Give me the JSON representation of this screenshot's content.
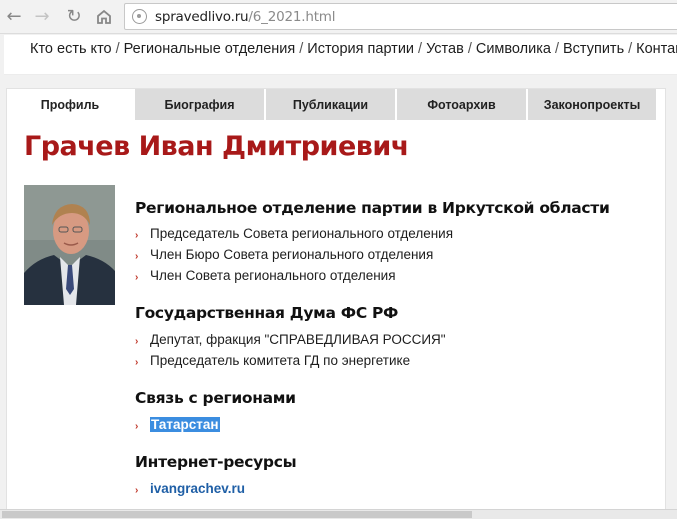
{
  "browser": {
    "url_domain": "spravedlivo.ru",
    "url_path": "/6_2021.html",
    "back_icon": "arrow-left",
    "forward_icon": "arrow-right",
    "reload_icon": "reload"
  },
  "topmenu": {
    "items": [
      "Кто есть кто",
      "Региональные отделения",
      "История партии",
      "Устав",
      "Символика",
      "Вступить",
      "Контак"
    ],
    "separator": "/"
  },
  "tabs": [
    "Профиль",
    "Биография",
    "Публикации",
    "Фотоархив",
    "Законопроекты"
  ],
  "active_tab": "Профиль",
  "profile": {
    "name": "Грачев Иван Дмитриевич",
    "sections": [
      {
        "heading": "Региональное отделение партии в Иркутской области",
        "items": [
          "Председатель Совета регионального отделения",
          "Член Бюро Совета регионального отделения",
          "Член Совета регионального отделения"
        ]
      },
      {
        "heading": "Государственная Дума ФС РФ",
        "items": [
          "Депутат, фракция \"СПРАВЕДЛИВАЯ РОССИЯ\"",
          "Председатель комитета ГД по энергетике"
        ]
      },
      {
        "heading": "Связь с регионами",
        "items": [
          "Татарстан"
        ]
      },
      {
        "heading": "Интернет-ресурсы",
        "items": [
          "ivangrachev.ru"
        ]
      }
    ]
  },
  "colors": {
    "title": "#a81919",
    "bullet": "#c0392b",
    "link": "#1f5fa6",
    "selection": "#3b8de0"
  }
}
